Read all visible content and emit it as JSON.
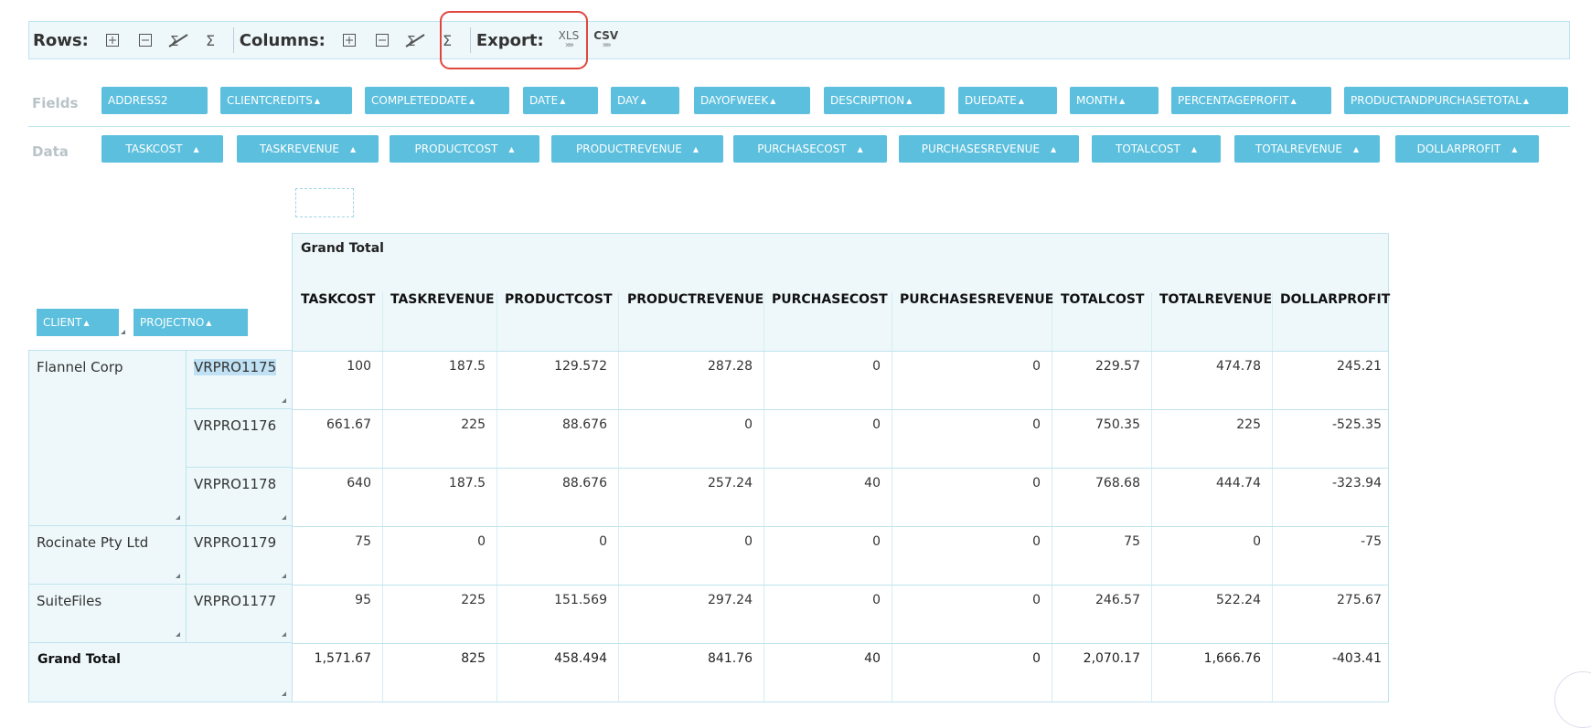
{
  "toolbar": {
    "rows_label": "Rows:",
    "columns_label": "Columns:",
    "export_label": "Export:",
    "export_xls": "XLS",
    "export_csv": "CSV",
    "export_arrows": "»»"
  },
  "fields": {
    "label": "Fields",
    "items": [
      "ADDRESS2",
      "CLIENTCREDITS",
      "COMPLETEDDATE",
      "DATE",
      "DAY",
      "DAYOFWEEK",
      "DESCRIPTION",
      "DUEDATE",
      "MONTH",
      "PERCENTAGEPROFIT",
      "PRODUCTANDPURCHASETOTAL"
    ]
  },
  "data_fields": {
    "label": "Data",
    "items": [
      "TASKCOST",
      "TASKREVENUE",
      "PRODUCTCOST",
      "PRODUCTREVENUE",
      "PURCHASECOST",
      "PURCHASESREVENUE",
      "TOTALCOST",
      "TOTALREVENUE",
      "DOLLARPROFIT"
    ]
  },
  "row_fields": [
    "CLIENT",
    "PROJECTNO"
  ],
  "sort_glyph": "▲",
  "pivot": {
    "grand_total_header": "Grand Total",
    "columns": [
      "TASKCOST",
      "TASKREVENUE",
      "PRODUCTCOST",
      "PRODUCTREVENUE",
      "PURCHASECOST",
      "PURCHASESREVENUE",
      "TOTALCOST",
      "TOTALREVENUE",
      "DOLLARPROFIT"
    ],
    "clients": [
      "Flannel Corp",
      "Rocinate Pty Ltd",
      "SuiteFiles"
    ],
    "rows": [
      {
        "project": "VRPRO1175",
        "values": [
          "100",
          "187.5",
          "129.572",
          "287.28",
          "0",
          "0",
          "229.57",
          "474.78",
          "245.21"
        ]
      },
      {
        "project": "VRPRO1176",
        "values": [
          "661.67",
          "225",
          "88.676",
          "0",
          "0",
          "0",
          "750.35",
          "225",
          "-525.35"
        ]
      },
      {
        "project": "VRPRO1178",
        "values": [
          "640",
          "187.5",
          "88.676",
          "257.24",
          "40",
          "0",
          "768.68",
          "444.74",
          "-323.94"
        ]
      },
      {
        "project": "VRPRO1179",
        "values": [
          "75",
          "0",
          "0",
          "0",
          "0",
          "0",
          "75",
          "0",
          "-75"
        ]
      },
      {
        "project": "VRPRO1177",
        "values": [
          "95",
          "225",
          "151.569",
          "297.24",
          "0",
          "0",
          "246.57",
          "522.24",
          "275.67"
        ]
      }
    ],
    "grand_total_label": "Grand Total",
    "grand_total_values": [
      "1,571.67",
      "825",
      "458.494",
      "841.76",
      "40",
      "0",
      "2,070.17",
      "1,666.76",
      "-403.41"
    ]
  }
}
